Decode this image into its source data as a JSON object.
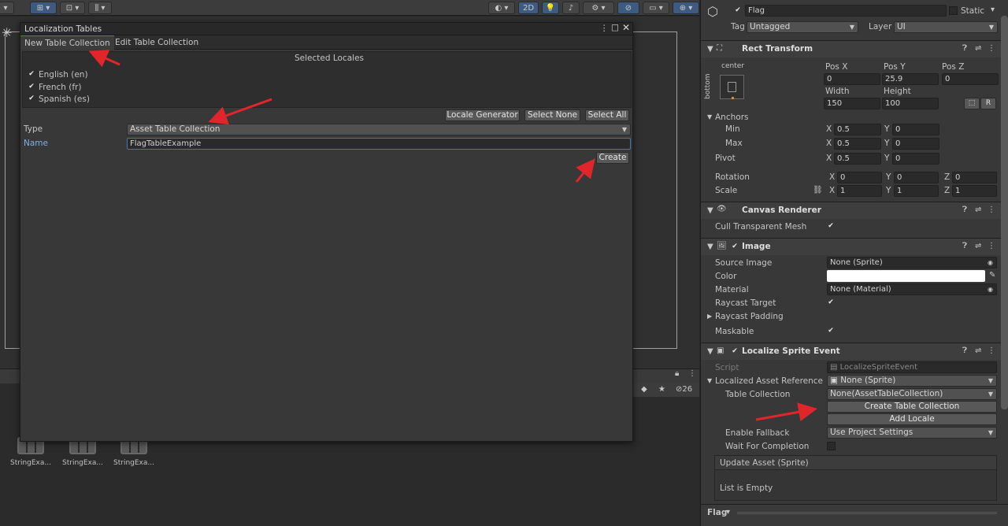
{
  "toolbar": {
    "btn_2d": "2D",
    "gizmo_count": "26"
  },
  "localization_window": {
    "title": "Localization Tables",
    "tabs": [
      "New Table Collection",
      "Edit Table Collection"
    ],
    "selected_locales_heading": "Selected Locales",
    "locales": [
      {
        "label": "English (en)",
        "checked": true
      },
      {
        "label": "French (fr)",
        "checked": true
      },
      {
        "label": "Spanish (es)",
        "checked": true
      }
    ],
    "buttons": {
      "locale_generator": "Locale Generator",
      "select_none": "Select None",
      "select_all": "Select All",
      "create": "Create"
    },
    "type_label": "Type",
    "type_value": "Asset Table Collection",
    "name_label": "Name",
    "name_value": "FlagTableExample"
  },
  "project": {
    "items": [
      "StringExa...",
      "StringExa...",
      "StringExa..."
    ]
  },
  "inspector": {
    "object_name": "Flag",
    "static_label": "Static",
    "tag_label": "Tag",
    "tag_value": "Untagged",
    "layer_label": "Layer",
    "layer_value": "UI",
    "rect_transform": {
      "title": "Rect Transform",
      "anchor_h": "center",
      "anchor_v": "bottom",
      "pos_x_label": "Pos X",
      "pos_y_label": "Pos Y",
      "pos_z_label": "Pos Z",
      "pos_x": "0",
      "pos_y": "25.9",
      "pos_z": "0",
      "width_label": "Width",
      "height_label": "Height",
      "width": "150",
      "height": "100",
      "anchors_label": "Anchors",
      "min_label": "Min",
      "max_label": "Max",
      "min_x": "0.5",
      "min_y": "0",
      "max_x": "0.5",
      "max_y": "0",
      "pivot_label": "Pivot",
      "pivot_x": "0.5",
      "pivot_y": "0",
      "rotation_label": "Rotation",
      "rot_x": "0",
      "rot_y": "0",
      "rot_z": "0",
      "scale_label": "Scale",
      "scale_x": "1",
      "scale_y": "1",
      "scale_z": "1",
      "x": "X",
      "y": "Y",
      "z": "Z",
      "r": "R"
    },
    "canvas_renderer": {
      "title": "Canvas Renderer",
      "cull_label": "Cull Transparent Mesh"
    },
    "image": {
      "title": "Image",
      "source_image_label": "Source Image",
      "source_image": "None (Sprite)",
      "color_label": "Color",
      "color_value": "#ffffff",
      "material_label": "Material",
      "material": "None (Material)",
      "raycast_target_label": "Raycast Target",
      "raycast_padding_label": "Raycast Padding",
      "maskable_label": "Maskable"
    },
    "localize_sprite_event": {
      "title": "Localize Sprite Event",
      "script_label": "Script",
      "script_value": "LocalizeSpriteEvent",
      "localized_asset_ref_label": "Localized Asset Reference",
      "localized_asset_ref_value": "None (Sprite)",
      "table_collection_label": "Table Collection",
      "table_collection_value": "None(AssetTableCollection)",
      "create_table_collection": "Create Table Collection",
      "add_locale": "Add Locale",
      "enable_fallback_label": "Enable Fallback",
      "enable_fallback_value": "Use Project Settings",
      "wait_label": "Wait For Completion",
      "update_asset_label": "Update Asset (Sprite)",
      "list_empty": "List is Empty"
    },
    "footer": "Flag"
  },
  "accent_color": "#3a79bb",
  "arrow_color": "#e0262b"
}
